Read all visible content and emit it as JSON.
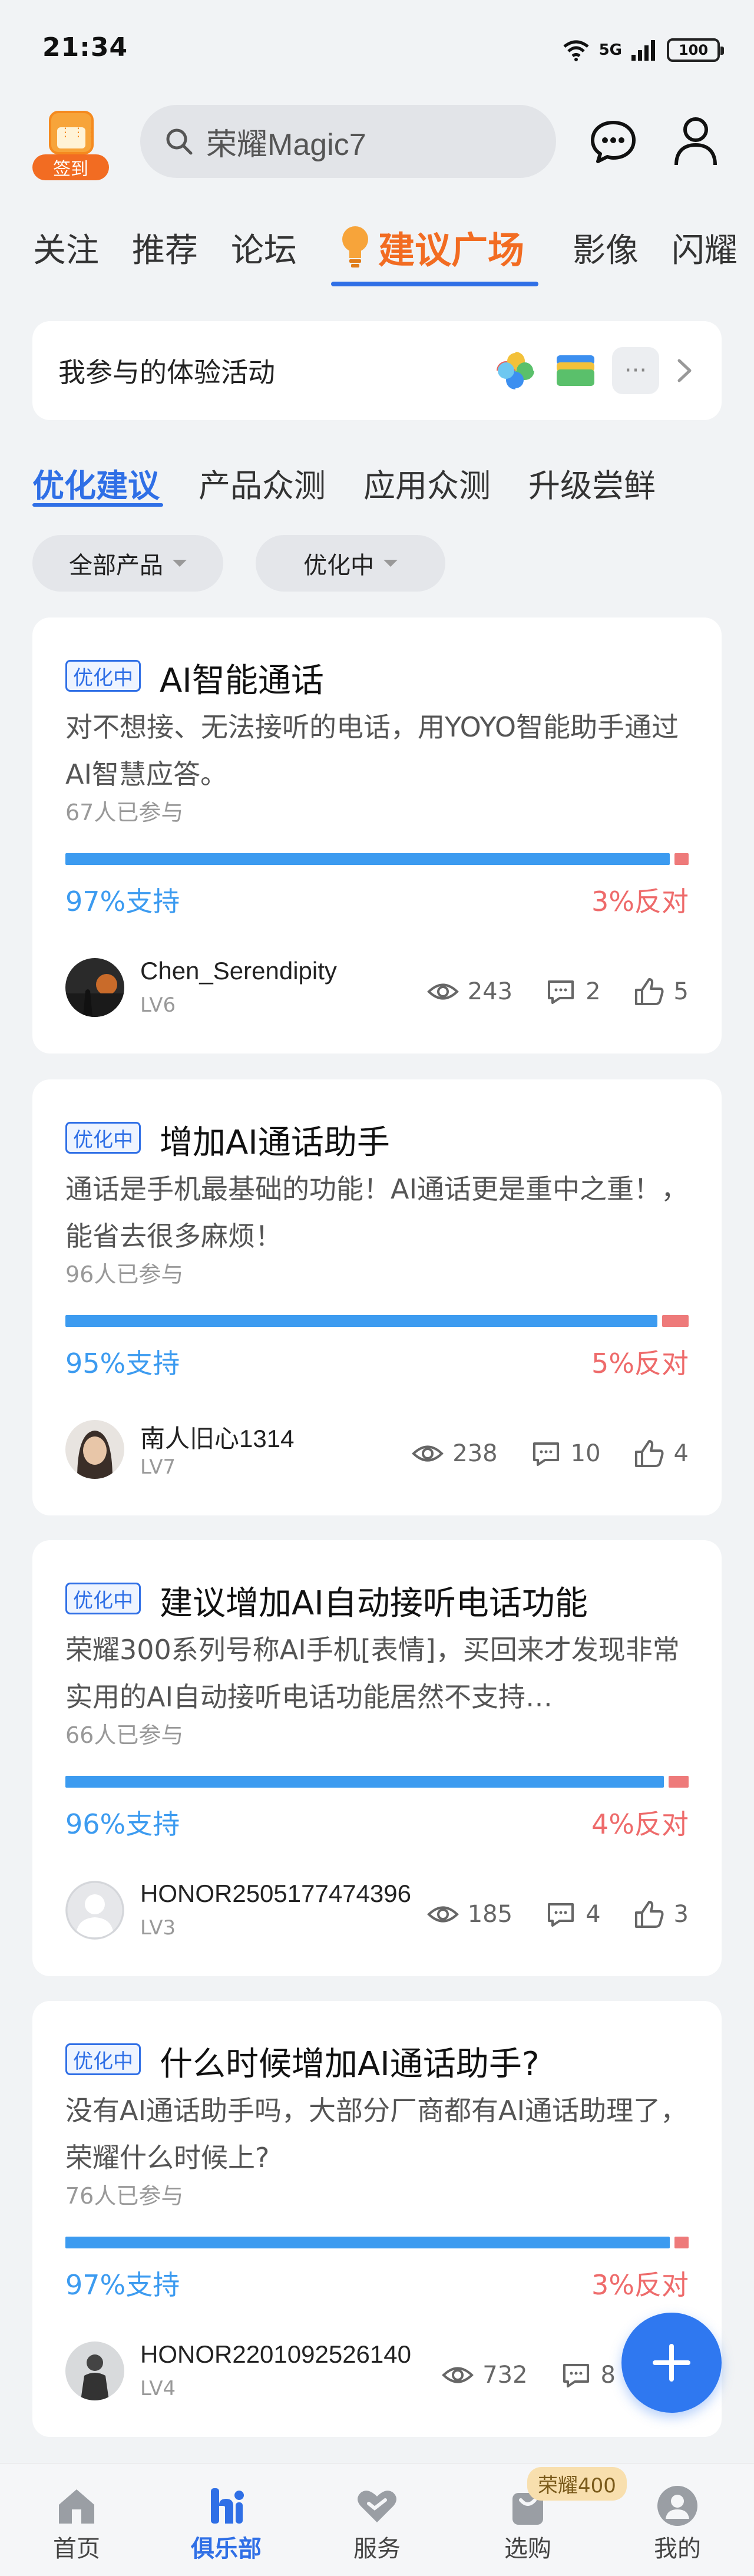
{
  "status_bar": {
    "time": "21:34",
    "network": "5G",
    "battery": "100"
  },
  "header": {
    "signin_label": "签到",
    "search_text": "荣耀Magic7"
  },
  "tabs": [
    "关注",
    "推荐",
    "论坛",
    "建议广场",
    "影像",
    "闪耀"
  ],
  "active_tab": "建议广场",
  "activity": {
    "title": "我参与的体验活动",
    "more": "···"
  },
  "subtabs": [
    "优化建议",
    "产品众测",
    "应用众测",
    "升级尝鲜"
  ],
  "filters": {
    "product": "全部产品",
    "status": "优化中"
  },
  "posts": [
    {
      "badge": "优化中",
      "title": "AI智能通话",
      "desc": "对不想接、无法接听的电话，用YOYO智能助手通过AI智慧应答。",
      "participants": "67人已参与",
      "support_pct": 97,
      "support_text": "97%支持",
      "oppose_text": "3%反对",
      "user": "Chen_Serendipity",
      "level": "LV6",
      "views": "243",
      "comments": "2",
      "likes": "5"
    },
    {
      "badge": "优化中",
      "title": "增加AI通话助手",
      "desc": "通话是手机最基础的功能！AI通话更是重中之重！，能省去很多麻烦！",
      "participants": "96人已参与",
      "support_pct": 95,
      "support_text": "95%支持",
      "oppose_text": "5%反对",
      "user": "南人旧心1314",
      "level": "LV7",
      "views": "238",
      "comments": "10",
      "likes": "4"
    },
    {
      "badge": "优化中",
      "title": "建议增加AI自动接听电话功能",
      "desc": "荣耀300系列号称AI手机[表情]，买回来才发现非常实用的AI自动接听电话功能居然不支持…",
      "participants": "66人已参与",
      "support_pct": 96,
      "support_text": "96%支持",
      "oppose_text": "4%反对",
      "user": "HONOR2505177474396",
      "level": "LV3",
      "views": "185",
      "comments": "4",
      "likes": "3"
    },
    {
      "badge": "优化中",
      "title": "什么时候增加AI通话助手?",
      "desc": "没有AI通话助手吗，大部分厂商都有AI通话助理了，荣耀什么时候上?",
      "participants": "76人已参与",
      "support_pct": 97,
      "support_text": "97%支持",
      "oppose_text": "3%反对",
      "user": "HONOR2201092526140",
      "level": "LV4",
      "views": "732",
      "comments": "8",
      "likes": ""
    }
  ],
  "bottom_nav": [
    {
      "label": "首页",
      "icon": "home-icon"
    },
    {
      "label": "俱乐部",
      "icon": "club-icon"
    },
    {
      "label": "服务",
      "icon": "heart-icon"
    },
    {
      "label": "选购",
      "icon": "shop-icon"
    },
    {
      "label": "我的",
      "icon": "profile-icon"
    }
  ],
  "nav_badge": "荣耀400",
  "colors": {
    "accent_blue": "#2f6fe6",
    "accent_orange": "#f26c22",
    "support": "#3c9bf0",
    "oppose": "#ee6b6b"
  }
}
